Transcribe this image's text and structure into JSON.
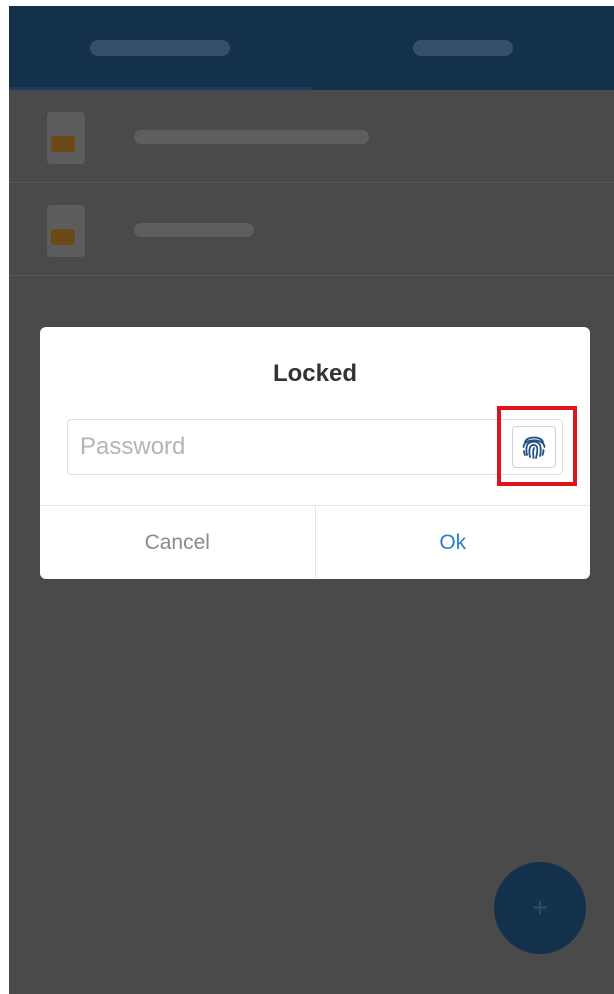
{
  "dialog": {
    "title": "Locked",
    "password_placeholder": "Password",
    "password_value": "",
    "fingerprint_icon": "fingerprint-icon",
    "cancel_label": "Cancel",
    "ok_label": "Ok"
  },
  "colors": {
    "header_bg": "#13314c",
    "overlay": "#4a4a4a",
    "accent_blue": "#2b7fd0",
    "highlight_red": "#e0141c",
    "fingerprint_blue": "#1f4f86"
  },
  "fab": {
    "icon": "add-icon"
  }
}
